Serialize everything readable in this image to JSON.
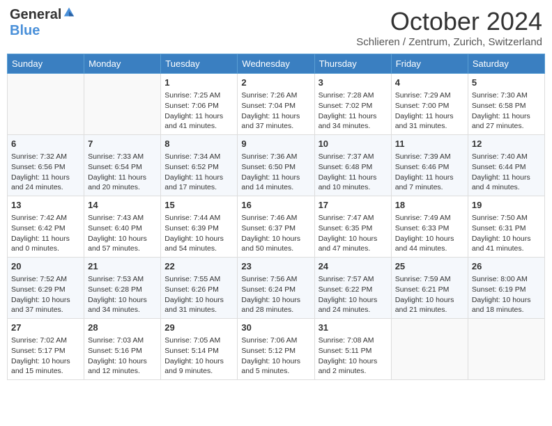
{
  "header": {
    "logo": {
      "general": "General",
      "blue": "Blue"
    },
    "title": "October 2024",
    "subtitle": "Schlieren / Zentrum, Zurich, Switzerland"
  },
  "weekdays": [
    "Sunday",
    "Monday",
    "Tuesday",
    "Wednesday",
    "Thursday",
    "Friday",
    "Saturday"
  ],
  "weeks": [
    [
      {
        "day": null
      },
      {
        "day": null
      },
      {
        "day": 1,
        "sunrise": "Sunrise: 7:25 AM",
        "sunset": "Sunset: 7:06 PM",
        "daylight": "Daylight: 11 hours and 41 minutes."
      },
      {
        "day": 2,
        "sunrise": "Sunrise: 7:26 AM",
        "sunset": "Sunset: 7:04 PM",
        "daylight": "Daylight: 11 hours and 37 minutes."
      },
      {
        "day": 3,
        "sunrise": "Sunrise: 7:28 AM",
        "sunset": "Sunset: 7:02 PM",
        "daylight": "Daylight: 11 hours and 34 minutes."
      },
      {
        "day": 4,
        "sunrise": "Sunrise: 7:29 AM",
        "sunset": "Sunset: 7:00 PM",
        "daylight": "Daylight: 11 hours and 31 minutes."
      },
      {
        "day": 5,
        "sunrise": "Sunrise: 7:30 AM",
        "sunset": "Sunset: 6:58 PM",
        "daylight": "Daylight: 11 hours and 27 minutes."
      }
    ],
    [
      {
        "day": 6,
        "sunrise": "Sunrise: 7:32 AM",
        "sunset": "Sunset: 6:56 PM",
        "daylight": "Daylight: 11 hours and 24 minutes."
      },
      {
        "day": 7,
        "sunrise": "Sunrise: 7:33 AM",
        "sunset": "Sunset: 6:54 PM",
        "daylight": "Daylight: 11 hours and 20 minutes."
      },
      {
        "day": 8,
        "sunrise": "Sunrise: 7:34 AM",
        "sunset": "Sunset: 6:52 PM",
        "daylight": "Daylight: 11 hours and 17 minutes."
      },
      {
        "day": 9,
        "sunrise": "Sunrise: 7:36 AM",
        "sunset": "Sunset: 6:50 PM",
        "daylight": "Daylight: 11 hours and 14 minutes."
      },
      {
        "day": 10,
        "sunrise": "Sunrise: 7:37 AM",
        "sunset": "Sunset: 6:48 PM",
        "daylight": "Daylight: 11 hours and 10 minutes."
      },
      {
        "day": 11,
        "sunrise": "Sunrise: 7:39 AM",
        "sunset": "Sunset: 6:46 PM",
        "daylight": "Daylight: 11 hours and 7 minutes."
      },
      {
        "day": 12,
        "sunrise": "Sunrise: 7:40 AM",
        "sunset": "Sunset: 6:44 PM",
        "daylight": "Daylight: 11 hours and 4 minutes."
      }
    ],
    [
      {
        "day": 13,
        "sunrise": "Sunrise: 7:42 AM",
        "sunset": "Sunset: 6:42 PM",
        "daylight": "Daylight: 11 hours and 0 minutes."
      },
      {
        "day": 14,
        "sunrise": "Sunrise: 7:43 AM",
        "sunset": "Sunset: 6:40 PM",
        "daylight": "Daylight: 10 hours and 57 minutes."
      },
      {
        "day": 15,
        "sunrise": "Sunrise: 7:44 AM",
        "sunset": "Sunset: 6:39 PM",
        "daylight": "Daylight: 10 hours and 54 minutes."
      },
      {
        "day": 16,
        "sunrise": "Sunrise: 7:46 AM",
        "sunset": "Sunset: 6:37 PM",
        "daylight": "Daylight: 10 hours and 50 minutes."
      },
      {
        "day": 17,
        "sunrise": "Sunrise: 7:47 AM",
        "sunset": "Sunset: 6:35 PM",
        "daylight": "Daylight: 10 hours and 47 minutes."
      },
      {
        "day": 18,
        "sunrise": "Sunrise: 7:49 AM",
        "sunset": "Sunset: 6:33 PM",
        "daylight": "Daylight: 10 hours and 44 minutes."
      },
      {
        "day": 19,
        "sunrise": "Sunrise: 7:50 AM",
        "sunset": "Sunset: 6:31 PM",
        "daylight": "Daylight: 10 hours and 41 minutes."
      }
    ],
    [
      {
        "day": 20,
        "sunrise": "Sunrise: 7:52 AM",
        "sunset": "Sunset: 6:29 PM",
        "daylight": "Daylight: 10 hours and 37 minutes."
      },
      {
        "day": 21,
        "sunrise": "Sunrise: 7:53 AM",
        "sunset": "Sunset: 6:28 PM",
        "daylight": "Daylight: 10 hours and 34 minutes."
      },
      {
        "day": 22,
        "sunrise": "Sunrise: 7:55 AM",
        "sunset": "Sunset: 6:26 PM",
        "daylight": "Daylight: 10 hours and 31 minutes."
      },
      {
        "day": 23,
        "sunrise": "Sunrise: 7:56 AM",
        "sunset": "Sunset: 6:24 PM",
        "daylight": "Daylight: 10 hours and 28 minutes."
      },
      {
        "day": 24,
        "sunrise": "Sunrise: 7:57 AM",
        "sunset": "Sunset: 6:22 PM",
        "daylight": "Daylight: 10 hours and 24 minutes."
      },
      {
        "day": 25,
        "sunrise": "Sunrise: 7:59 AM",
        "sunset": "Sunset: 6:21 PM",
        "daylight": "Daylight: 10 hours and 21 minutes."
      },
      {
        "day": 26,
        "sunrise": "Sunrise: 8:00 AM",
        "sunset": "Sunset: 6:19 PM",
        "daylight": "Daylight: 10 hours and 18 minutes."
      }
    ],
    [
      {
        "day": 27,
        "sunrise": "Sunrise: 7:02 AM",
        "sunset": "Sunset: 5:17 PM",
        "daylight": "Daylight: 10 hours and 15 minutes."
      },
      {
        "day": 28,
        "sunrise": "Sunrise: 7:03 AM",
        "sunset": "Sunset: 5:16 PM",
        "daylight": "Daylight: 10 hours and 12 minutes."
      },
      {
        "day": 29,
        "sunrise": "Sunrise: 7:05 AM",
        "sunset": "Sunset: 5:14 PM",
        "daylight": "Daylight: 10 hours and 9 minutes."
      },
      {
        "day": 30,
        "sunrise": "Sunrise: 7:06 AM",
        "sunset": "Sunset: 5:12 PM",
        "daylight": "Daylight: 10 hours and 5 minutes."
      },
      {
        "day": 31,
        "sunrise": "Sunrise: 7:08 AM",
        "sunset": "Sunset: 5:11 PM",
        "daylight": "Daylight: 10 hours and 2 minutes."
      },
      {
        "day": null
      },
      {
        "day": null
      }
    ]
  ]
}
